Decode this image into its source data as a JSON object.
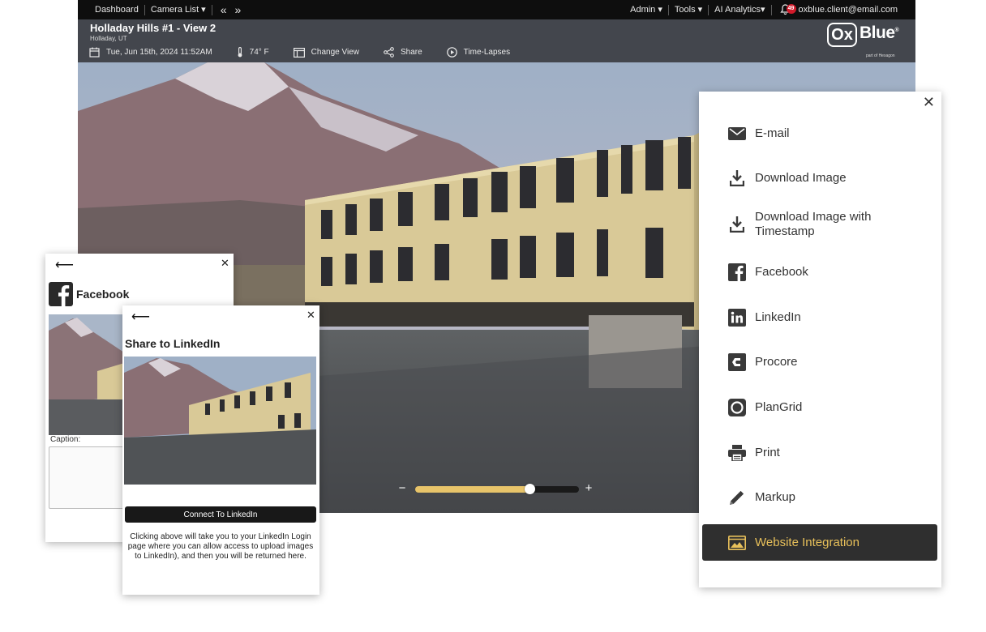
{
  "nav": {
    "dashboard": "Dashboard",
    "camera_list": "Camera List ▾",
    "back_glyph": "«",
    "forward_glyph": "»",
    "admin": "Admin ▾",
    "tools": "Tools ▾",
    "ai_analytics": "AI Analytics▾",
    "notification_count": "49",
    "user_email": "oxblue.client@email.com"
  },
  "header": {
    "camera_title": "Holladay Hills #1 - View 2",
    "location": "Holladay, UT",
    "datetime": "Tue, Jun 15th, 2024 11:52AM",
    "temperature": "74° F",
    "change_view": "Change View",
    "share": "Share",
    "time_lapses": "Time-Lapses"
  },
  "logo": {
    "box": "Ox",
    "text": "Blue",
    "reg": "®",
    "sub": "part of Hexagon"
  },
  "zoom": {
    "minus": "−",
    "plus": "+",
    "level": 0.7
  },
  "share_menu": {
    "items": [
      {
        "label": "E-mail",
        "icon": "envelope-icon"
      },
      {
        "label": "Download Image",
        "icon": "download-icon"
      },
      {
        "label": "Download Image with Timestamp",
        "icon": "download-icon"
      },
      {
        "label": "Facebook",
        "icon": "facebook-icon"
      },
      {
        "label": "LinkedIn",
        "icon": "linkedin-icon"
      },
      {
        "label": "Procore",
        "icon": "procore-icon"
      },
      {
        "label": "PlanGrid",
        "icon": "plangrid-icon"
      },
      {
        "label": "Print",
        "icon": "printer-icon"
      },
      {
        "label": "Markup",
        "icon": "pencil-icon"
      }
    ],
    "website_integration": "Website Integration",
    "accent_color": "#e8c05a"
  },
  "facebook_dialog": {
    "title": "Facebook",
    "caption_label": "Caption:",
    "caption_value": ""
  },
  "linkedin_dialog": {
    "title": "Share to LinkedIn",
    "connect_button": "Connect To LinkedIn",
    "help_text": "Clicking above will take you to your LinkedIn Login page where you can allow access to upload images to LinkedIn), and then you will be returned here."
  },
  "glyphs": {
    "back": "⟵",
    "close": "✕"
  }
}
